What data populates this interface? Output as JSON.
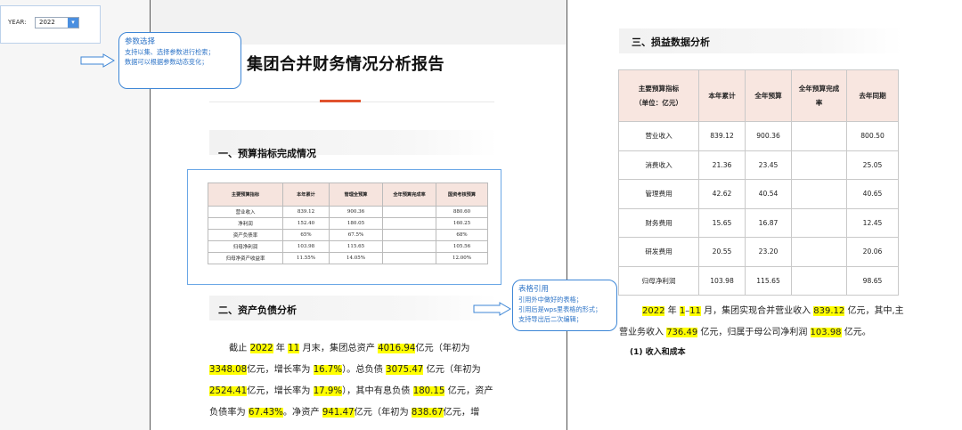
{
  "param": {
    "year_label": "YEAR:",
    "year_value": "2022"
  },
  "callout_params": {
    "title": "参数选择",
    "lines": [
      "支持以集、选择参数进行检索；",
      "数据可以根据参数动态变化；"
    ]
  },
  "callout_table": {
    "title": "表格引用",
    "lines": [
      "引用外中做好的表格；",
      "引用后是wps里表格的形式；",
      "支持导出后二次编辑；"
    ]
  },
  "doc": {
    "title": "集团合并财务情况分析报告",
    "sec1": "一、预算指标完成情况",
    "sec2": "二、资产负债分析",
    "sec3": "三、损益数据分析"
  },
  "mini_table": {
    "headers": [
      "主要预算指标",
      "本年累计",
      "管理全预算",
      "全年预算完成率",
      "国资考核预算"
    ],
    "rows": [
      [
        "营业收入",
        "839.12",
        "900.36",
        "",
        "880.60"
      ],
      [
        "净利润",
        "152.40",
        "180.05",
        "",
        "160.25"
      ],
      [
        "资产负债率",
        "65%",
        "67.5%",
        "",
        "68%"
      ],
      [
        "归母净利润",
        "103.98",
        "115.65",
        "",
        "105.56"
      ],
      [
        "归母净资产收益率",
        "11.55%",
        "14.05%",
        "",
        "12.00%"
      ]
    ]
  },
  "para_left": {
    "t1": "截止 ",
    "h1": "2022",
    "t2": " 年 ",
    "h2": "11",
    "t3": " 月末，集团总资产 ",
    "h3": "4016.94",
    "t4": "亿元（年初为 ",
    "h4": "3348.08",
    "t5": "亿元，增长率为 ",
    "h5": "16.7%",
    "t6": "）。总负债 ",
    "h6": "3075.47",
    "t7": " 亿元（年初为 ",
    "h7": "2524.41",
    "t8": "亿元，增长率为 ",
    "h8": "17.9%",
    "t9": "），其中有息负债 ",
    "h9": "180.15",
    "t10": " 亿元，资产负债率为 ",
    "h10": "67.43%",
    "t11": "。净资产 ",
    "h11": "941.47",
    "t12": "亿元（年初为 ",
    "h12": "838.67",
    "t13": "亿元，增"
  },
  "big_table": {
    "headers": [
      "主要预算指标\n（单位：亿元）",
      "本年累计",
      "全年预算",
      "全年预算完成\n率",
      "去年同期"
    ],
    "rows": [
      [
        "营业收入",
        "839.12",
        "900.36",
        "",
        "800.50"
      ],
      [
        "消费收入",
        "21.36",
        "23.45",
        "",
        "25.05"
      ],
      [
        "管理费用",
        "42.62",
        "40.54",
        "",
        "40.65"
      ],
      [
        "财务费用",
        "15.65",
        "16.87",
        "",
        "12.45"
      ],
      [
        "研发费用",
        "20.55",
        "23.20",
        "",
        "20.06"
      ],
      [
        "归母净利润",
        "103.98",
        "115.65",
        "",
        "98.65"
      ]
    ]
  },
  "para_right": {
    "h1": "2022",
    "t1": " 年 ",
    "h2": "1",
    "t2": "–",
    "h3": "11",
    "t3": " 月，集团实现合并营业收入 ",
    "h4": "839.12",
    "t4": " 亿元，其中,",
    "t5": "主营业务收入 ",
    "h5": "736.49",
    "t6": " 亿元，归属于母公司净利润 ",
    "h6": "103.98",
    "t7": " 亿元。"
  },
  "sub_heading": "(1) 收入和成本"
}
